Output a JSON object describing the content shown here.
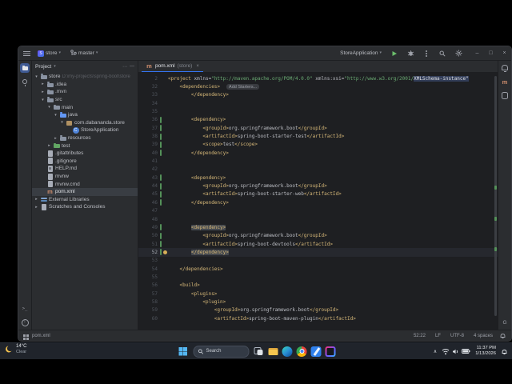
{
  "glyphs": {
    "chevron_down": "▾",
    "arrow_down": "▾",
    "arrow_right": "▸",
    "minimize": "–",
    "maximize": "□",
    "close": "×",
    "tray_chevron": "∧",
    "tab_close": "×"
  },
  "colors": {
    "accent_blue": "#3574f0",
    "run_green": "#6cbe6c",
    "tag_gold": "#d5b778",
    "string_green": "#6aab73",
    "change_green": "#549159",
    "selection_gray": "#393d43",
    "taskbar_bg": "#20242b",
    "editor_bg": "#1e1f22",
    "panel_bg": "#2b2d30"
  },
  "title_bar": {
    "project": "store",
    "project_initial": "S",
    "branch": "master",
    "run_config": "StoreApplication"
  },
  "tab": {
    "file": "pom.xml",
    "scope": "(store)"
  },
  "icons": {
    "left_stripe_top": [
      "project",
      "commit"
    ],
    "left_stripe_bottom": [
      "terminal",
      "problems"
    ],
    "right_stripe_top": [
      "notifications",
      "maven",
      "database"
    ],
    "right_stripe_bottom": [
      "gradle"
    ],
    "taskbar_apps": [
      "task-view",
      "file-explorer",
      "edge",
      "chrome",
      "vscode",
      "intellij"
    ]
  },
  "project_panel": {
    "header": "Project",
    "items": [
      {
        "label": "store",
        "icon": "project-folder",
        "depth": 0,
        "arrow": "down",
        "sub": "D:\\my-projects\\spring-boot\\store"
      },
      {
        "label": ".idea",
        "icon": "folder",
        "depth": 1,
        "arrow": "right"
      },
      {
        "label": ".mvn",
        "icon": "folder",
        "depth": 1,
        "arrow": "right"
      },
      {
        "label": "src",
        "icon": "folder",
        "depth": 1,
        "arrow": "down"
      },
      {
        "label": "main",
        "icon": "folder",
        "depth": 2,
        "arrow": "down"
      },
      {
        "label": "java",
        "icon": "folder-java",
        "depth": 3,
        "arrow": "down"
      },
      {
        "label": "com.dabananda.store",
        "icon": "package",
        "depth": 4,
        "arrow": "down"
      },
      {
        "label": "StoreApplication",
        "icon": "class",
        "depth": 5
      },
      {
        "label": "resources",
        "icon": "folder-res",
        "depth": 3,
        "arrow": "right"
      },
      {
        "label": "test",
        "icon": "folder-test",
        "depth": 2,
        "arrow": "right"
      },
      {
        "label": ".gitattributes",
        "icon": "file",
        "depth": 1
      },
      {
        "label": ".gitignore",
        "icon": "file",
        "depth": 1
      },
      {
        "label": "HELP.md",
        "icon": "md",
        "depth": 1
      },
      {
        "label": "mvnw",
        "icon": "file",
        "depth": 1
      },
      {
        "label": "mvnw.cmd",
        "icon": "file",
        "depth": 1
      },
      {
        "label": "pom.xml",
        "icon": "maven",
        "depth": 1,
        "selected": true
      },
      {
        "label": "External Libraries",
        "icon": "libs",
        "depth": 0,
        "arrow": "right"
      },
      {
        "label": "Scratches and Consoles",
        "icon": "scratch",
        "depth": 0,
        "arrow": "right"
      }
    ]
  },
  "editor": {
    "inlay_hint": "Add Starters...",
    "lines": [
      {
        "n": 2,
        "i": 0,
        "seg": [
          [
            "tag",
            "<project "
          ],
          [
            "attr",
            "xmlns="
          ],
          [
            "str",
            "\"http://maven.apache.org/POM/4.0.0\""
          ],
          [
            "attr",
            " xmlns:xsi="
          ],
          [
            "str",
            "\"http://www.w3.org/2001/"
          ],
          [
            "strhl",
            "XMLSchema-instance\""
          ]
        ]
      },
      {
        "n": 32,
        "i": 1,
        "seg": [
          [
            "tag",
            "<dependencies>"
          ]
        ],
        "inlay": true
      },
      {
        "n": 33,
        "i": 2,
        "seg": [
          [
            "tag",
            "</dependency>"
          ]
        ]
      },
      {
        "n": 34,
        "i": 0,
        "seg": []
      },
      {
        "n": 35,
        "i": 0,
        "seg": []
      },
      {
        "n": 36,
        "i": 2,
        "ch": true,
        "seg": [
          [
            "tag",
            "<dependency>"
          ]
        ]
      },
      {
        "n": 37,
        "i": 3,
        "ch": true,
        "seg": [
          [
            "tag",
            "<groupId>"
          ],
          [
            "txt",
            "org.springframework.boot"
          ],
          [
            "tag",
            "</groupId>"
          ]
        ]
      },
      {
        "n": 38,
        "i": 3,
        "ch": true,
        "seg": [
          [
            "tag",
            "<artifactId>"
          ],
          [
            "txt",
            "spring-boot-starter-test"
          ],
          [
            "tag",
            "</artifactId>"
          ]
        ]
      },
      {
        "n": 39,
        "i": 3,
        "ch": true,
        "seg": [
          [
            "tag",
            "<scope>"
          ],
          [
            "txt",
            "test"
          ],
          [
            "tag",
            "</scope>"
          ]
        ]
      },
      {
        "n": 40,
        "i": 2,
        "ch": true,
        "seg": [
          [
            "tag",
            "</dependency>"
          ]
        ]
      },
      {
        "n": 41,
        "i": 0,
        "seg": []
      },
      {
        "n": 42,
        "i": 0,
        "seg": []
      },
      {
        "n": 43,
        "i": 2,
        "ch": true,
        "seg": [
          [
            "tag",
            "<dependency>"
          ]
        ]
      },
      {
        "n": 44,
        "i": 3,
        "ch": true,
        "seg": [
          [
            "tag",
            "<groupId>"
          ],
          [
            "txt",
            "org.springframework.boot"
          ],
          [
            "tag",
            "</groupId>"
          ]
        ]
      },
      {
        "n": 45,
        "i": 3,
        "ch": true,
        "seg": [
          [
            "tag",
            "<artifactId>"
          ],
          [
            "txt",
            "spring-boot-starter-web"
          ],
          [
            "tag",
            "</artifactId>"
          ]
        ]
      },
      {
        "n": 46,
        "i": 2,
        "ch": true,
        "seg": [
          [
            "tag",
            "</dependency>"
          ]
        ]
      },
      {
        "n": 47,
        "i": 0,
        "seg": []
      },
      {
        "n": 48,
        "i": 0,
        "seg": []
      },
      {
        "n": 49,
        "i": 2,
        "ch": true,
        "seg": [
          [
            "taghl",
            "<dependency>"
          ]
        ]
      },
      {
        "n": 50,
        "i": 3,
        "ch": true,
        "seg": [
          [
            "tag",
            "<groupId>"
          ],
          [
            "txt",
            "org.springframework.boot"
          ],
          [
            "tag",
            "</groupId>"
          ]
        ]
      },
      {
        "n": 51,
        "i": 3,
        "ch": true,
        "seg": [
          [
            "tag",
            "<artifactId>"
          ],
          [
            "txt",
            "spring-boot-devtools"
          ],
          [
            "tag",
            "</artifactId>"
          ]
        ]
      },
      {
        "n": 52,
        "i": 2,
        "ch": true,
        "caret": true,
        "bulb": true,
        "seg": [
          [
            "taghl",
            "</dependency>"
          ]
        ]
      },
      {
        "n": 53,
        "i": 0,
        "seg": []
      },
      {
        "n": 54,
        "i": 1,
        "seg": [
          [
            "tag",
            "</dependencies>"
          ]
        ]
      },
      {
        "n": 55,
        "i": 0,
        "seg": []
      },
      {
        "n": 56,
        "i": 1,
        "seg": [
          [
            "tag",
            "<build>"
          ]
        ]
      },
      {
        "n": 57,
        "i": 2,
        "seg": [
          [
            "tag",
            "<plugins>"
          ]
        ]
      },
      {
        "n": 58,
        "i": 3,
        "seg": [
          [
            "tag",
            "<plugin>"
          ]
        ]
      },
      {
        "n": 59,
        "i": 4,
        "seg": [
          [
            "tag",
            "<groupId>"
          ],
          [
            "txt",
            "org.springframework.boot"
          ],
          [
            "tag",
            "</groupId>"
          ]
        ]
      },
      {
        "n": 60,
        "i": 4,
        "seg": [
          [
            "tag",
            "<artifactId>"
          ],
          [
            "txt",
            "spring-boot-maven-plugin"
          ],
          [
            "tag",
            "</artifactId>"
          ]
        ]
      }
    ]
  },
  "status_bar": {
    "file": "pom.xml",
    "caret": "52:22",
    "line_sep": "LF",
    "encoding": "UTF-8",
    "indent": "4 spaces"
  },
  "taskbar": {
    "weather": {
      "temp": "14°C",
      "desc": "Clear"
    },
    "search": "Search",
    "clock": {
      "time": "11:37 PM",
      "date": "1/13/2026"
    }
  }
}
